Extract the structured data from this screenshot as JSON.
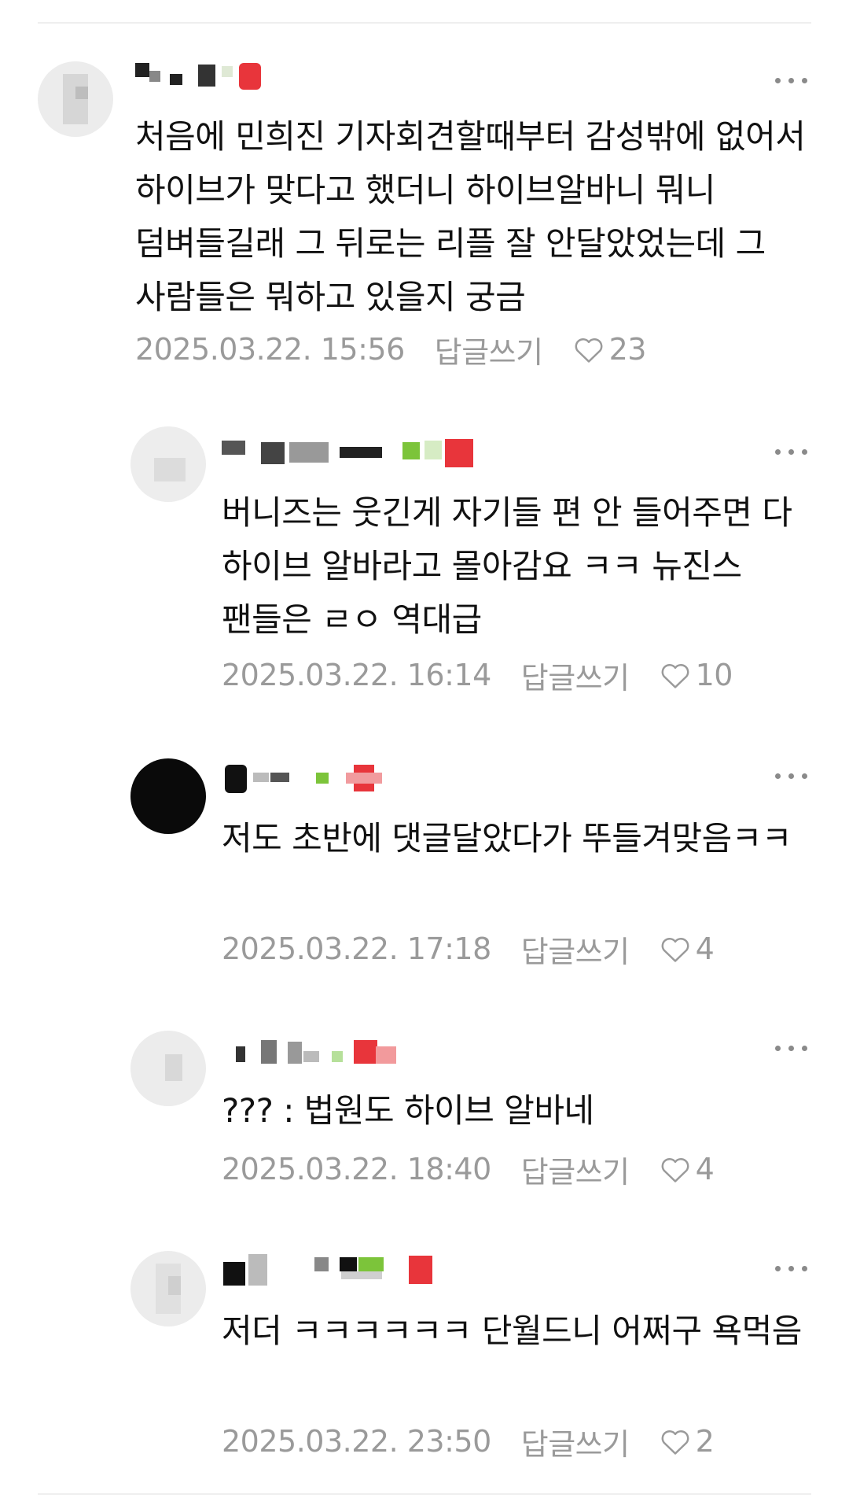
{
  "reply_label": "답글쓰기",
  "comments": [
    {
      "text": "처음에 민희진 기자회견할때부터 감성밖에 없어서 하이브가 맞다고 했더니 하이브알바니 뭐니 덤벼들길래 그 뒤로는 리플 잘 안달았었는데 그 사람들은 뭐하고 있을지 궁금",
      "date": "2025.03.22. 15:56",
      "likes": "23"
    },
    {
      "text": "버니즈는 웃긴게 자기들 편 안 들어주면 다 하이브 알바라고 몰아감요 ㅋㅋ 뉴진스 팬들은 ㄹㅇ 역대급",
      "date": "2025.03.22. 16:14",
      "likes": "10"
    },
    {
      "text": "저도 초반에 댓글달았다가 뚜들겨맞음ㅋㅋ",
      "date": "2025.03.22. 17:18",
      "likes": "4"
    },
    {
      "text": "??? : 법원도 하이브 알바네",
      "date": "2025.03.22. 18:40",
      "likes": "4"
    },
    {
      "text": "저더 ㅋㅋㅋㅋㅋㅋ 단월드니 어쩌구 욕먹음",
      "date": "2025.03.22. 23:50",
      "likes": "2"
    }
  ],
  "colors": {
    "text": "#111111",
    "meta": "#9a9a9a",
    "divider": "#efefef",
    "badge_red": "#e8353b",
    "badge_green": "#7cc43a"
  }
}
